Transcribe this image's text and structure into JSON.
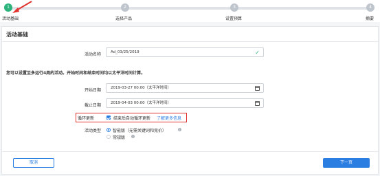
{
  "steps": [
    {
      "number": "1",
      "label": "活动基础",
      "active": true
    },
    {
      "number": "2",
      "label": "选择产品",
      "active": false
    },
    {
      "number": "3",
      "label": "设置预算",
      "active": false
    },
    {
      "number": "4",
      "label": "摘要",
      "active": false
    }
  ],
  "card": {
    "title": "活动基础",
    "name_label": "活动名称",
    "name_value": "Ad_03/25/2019",
    "schedule_note": "您可以设置至多运行4周的活动。开始时间和结束时间均以太平洋时间计算。",
    "start_label": "开始日期",
    "start_value": "2019-03-27 00:00（太平洋时间）",
    "end_label": "截止日期",
    "end_value": "2019-04-03 00:00（太平洋时间）",
    "loop_label": "循环更新",
    "loop_checkbox_text": "结束后自动循环更新",
    "loop_link": "了解更多信息",
    "type_label": "活动类型",
    "type_option_smart": "智能版（无需关键词和竞价）",
    "type_option_normal": "常规版"
  },
  "footer": {
    "cancel_label": "取消",
    "next_label": "下一页"
  },
  "colors": {
    "accent": "#2a7de1",
    "step_active": "#2db47d",
    "highlight": "#e0332e"
  }
}
